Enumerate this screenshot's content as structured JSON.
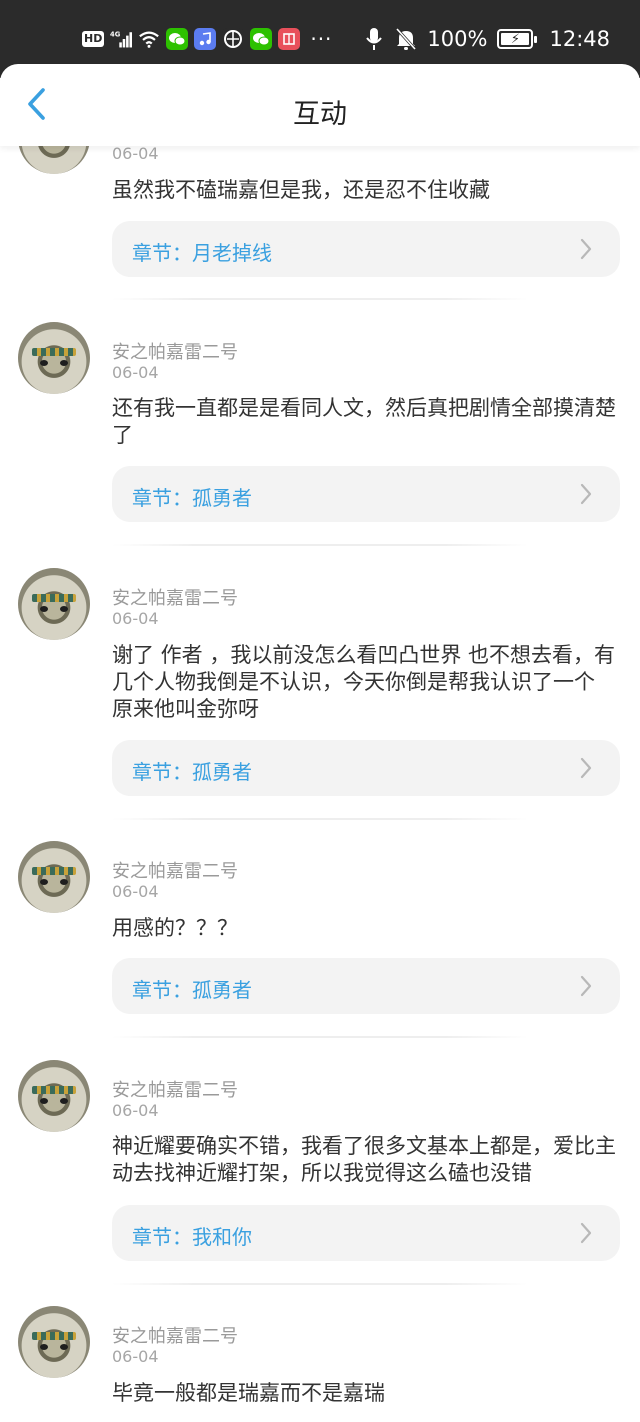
{
  "status_bar": {
    "hd": "HD",
    "network": "4G",
    "battery_percent": "100%",
    "time": "12:48",
    "more": "···",
    "icons": [
      "hd-icon",
      "signal-icon",
      "wifi-icon",
      "wechat-icon",
      "music-icon",
      "app-icon",
      "wechat-icon",
      "book-icon",
      "mic-icon",
      "mute-icon",
      "battery-icon"
    ]
  },
  "header": {
    "title": "互动",
    "back_icon": "chevron-left-icon",
    "accent": "#3aa0e0"
  },
  "comments": [
    {
      "author": "",
      "date": "06-04",
      "text": "虽然我不磕瑞嘉但是我，还是忍不住收藏",
      "chapter": "章节：月老掉线"
    },
    {
      "author": "安之帕嘉雷二号",
      "date": "06-04",
      "text": "还有我一直都是是看同人文，然后真把剧情全部摸清楚了",
      "chapter": "章节：孤勇者"
    },
    {
      "author": "安之帕嘉雷二号",
      "date": "06-04",
      "text": "谢了 作者 ，我以前没怎么看凹凸世界 也不想去看，有几个人物我倒是不认识，今天你倒是帮我认识了一个 原来他叫金弥呀",
      "chapter": "章节：孤勇者"
    },
    {
      "author": "安之帕嘉雷二号",
      "date": "06-04",
      "text": "用感的？？？",
      "chapter": "章节：孤勇者"
    },
    {
      "author": "安之帕嘉雷二号",
      "date": "06-04",
      "text": "神近耀要确实不错，我看了很多文基本上都是，爱比主动去找神近耀打架，所以我觉得这么磕也没错",
      "chapter": "章节：我和你"
    },
    {
      "author": "安之帕嘉雷二号",
      "date": "06-04",
      "text": "毕竟一般都是瑞嘉而不是嘉瑞",
      "chapter": ""
    }
  ]
}
